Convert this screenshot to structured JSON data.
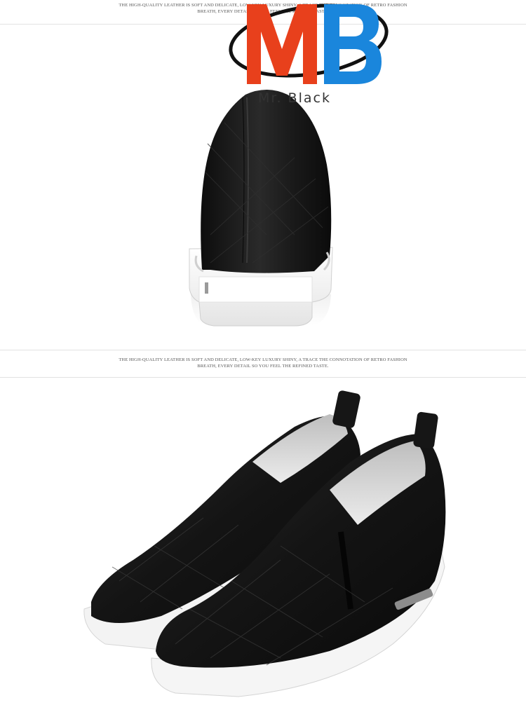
{
  "section1": {
    "caption_line1": "THE HIGH-QUALITY LEATHER IS SOFT AND DELICATE, LOW-KEY LUXURY SHINY, A TRACE THE CONNOTATION OF RETRO FASHION",
    "caption_line2": "BREATH, EVERY DETAIL SO YOU FEEL THE REFINED TASTE."
  },
  "section2": {
    "caption_line1": "THE HIGH-QUALITY LEATHER IS SOFT AND DELICATE, LOW-KEY LUXURY SHINY, A TRACE THE CONNOTATION OF RETRO FASHION",
    "caption_line2": "BREATH, EVERY DETAIL SO YOU FEEL THE REFINED TASTE."
  },
  "logo": {
    "letters": "MB",
    "wordmark": "Mr. Black",
    "colors": {
      "m": "#e8401c",
      "b": "#1a86dc",
      "ring": "#111111"
    }
  },
  "product": {
    "colors": {
      "leather": "#151515",
      "sole": "#f4f4f4",
      "lining": "#d9d9d9"
    }
  }
}
